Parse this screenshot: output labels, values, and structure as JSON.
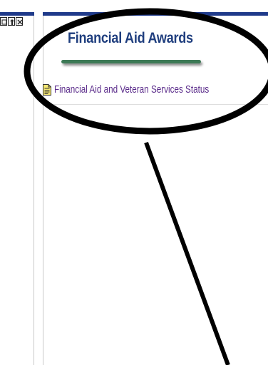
{
  "pagelet": {
    "title": "Financial Aid Awards",
    "link_label": "Financial Aid and Veteran Services Status"
  },
  "icons": {
    "left_pagelet_controls": [
      "minimize-icon",
      "refresh-icon",
      "close-icon"
    ],
    "link_icon": "document-icon"
  },
  "colors": {
    "header_bar": "#1f3a8a",
    "title_text": "#1f3e7e",
    "title_underline": "#3d7a56",
    "link_text": "#5a2b8a",
    "annotation": "#000000"
  }
}
